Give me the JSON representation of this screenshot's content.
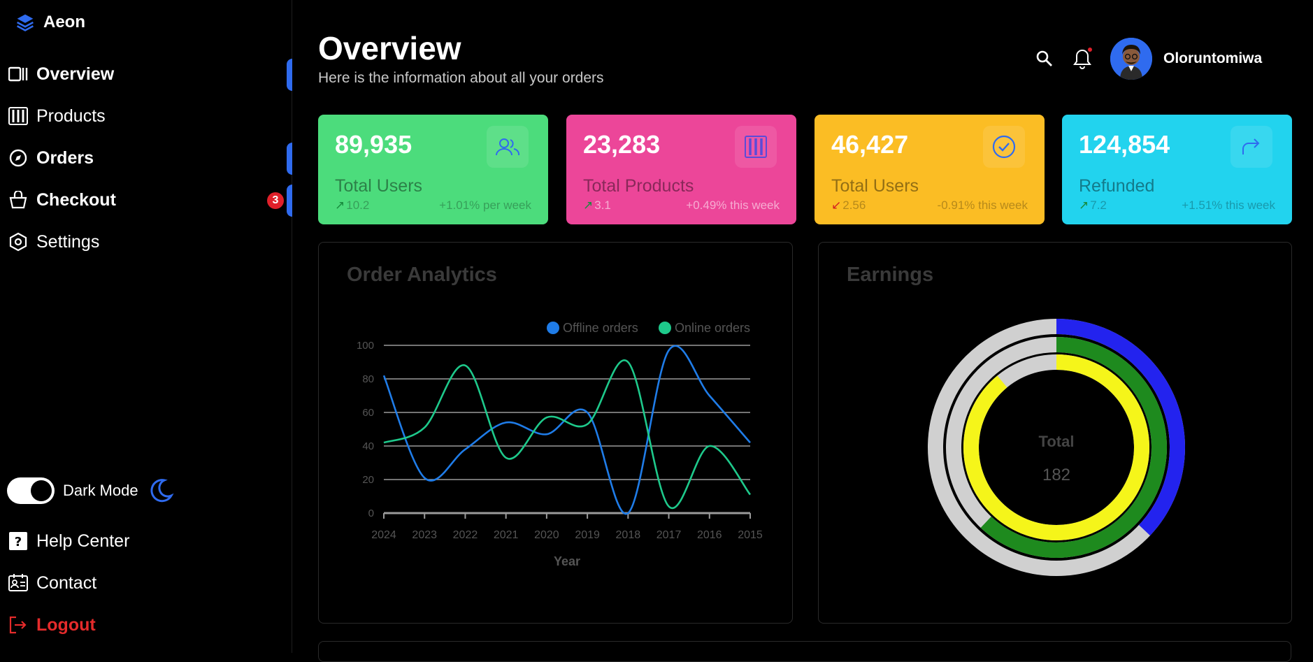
{
  "brand": {
    "name": "Aeon"
  },
  "sidebar": {
    "items": [
      {
        "label": "Overview",
        "bold": true,
        "active": true
      },
      {
        "label": "Products",
        "bold": false,
        "active": false
      },
      {
        "label": "Orders",
        "bold": true,
        "active": true
      },
      {
        "label": "Checkout",
        "bold": true,
        "active": true,
        "badge": "3"
      },
      {
        "label": "Settings",
        "bold": false,
        "active": false
      }
    ],
    "dark_mode_label": "Dark Mode",
    "dark_mode_on": true,
    "bottom": [
      {
        "label": "Help Center"
      },
      {
        "label": "Contact"
      },
      {
        "label": "Logout"
      }
    ]
  },
  "header": {
    "title": "Overview",
    "subtitle": "Here is the information about all your orders",
    "user_name": "Oloruntomiwa"
  },
  "cards": [
    {
      "value": "89,935",
      "label": "Total Users",
      "delta": "10.2",
      "trend": "+1.01% per week",
      "color": "#4cdc7c",
      "dir": "up"
    },
    {
      "value": "23,283",
      "label": "Total Products",
      "delta": "3.1",
      "trend": "+0.49% this week",
      "color": "#ec4699",
      "dir": "up"
    },
    {
      "value": "46,427",
      "label": "Total Users",
      "delta": "2.56",
      "trend": "-0.91% this week",
      "color": "#fbbd24",
      "dir": "down"
    },
    {
      "value": "124,854",
      "label": "Refunded",
      "delta": "7.2",
      "trend": "+1.51% this week",
      "color": "#22d3ee",
      "dir": "up"
    }
  ],
  "order_analytics": {
    "title": "Order Analytics",
    "chart_data": {
      "type": "line",
      "x": [
        "2024",
        "2023",
        "2022",
        "2021",
        "2020",
        "2019",
        "2018",
        "2017",
        "2016",
        "2015"
      ],
      "xlabel": "Year",
      "ylabel": "",
      "ylim": [
        0,
        100
      ],
      "yticks": [
        0,
        20,
        40,
        60,
        80,
        100
      ],
      "grid": true,
      "legend": "top-right",
      "series": [
        {
          "name": "Offline orders",
          "color": "#1f7ce8",
          "values": [
            82,
            21,
            38,
            54,
            47,
            60,
            0,
            97,
            70,
            42
          ]
        },
        {
          "name": "Online orders",
          "color": "#1ec98b",
          "values": [
            42,
            51,
            88,
            33,
            57,
            53,
            90,
            4,
            40,
            11
          ]
        }
      ]
    }
  },
  "earnings": {
    "title": "Earnings",
    "total_label": "Total",
    "total_value": "182",
    "chart_data": {
      "type": "pie",
      "rings": [
        {
          "fraction": 0.37,
          "color": "#2323ee",
          "track": "#d0d0d0"
        },
        {
          "fraction": 0.62,
          "color": "#1e8a1e",
          "track": "#d0d0d0"
        },
        {
          "fraction": 0.89,
          "color": "#f5f51a",
          "track": "#d0d0d0"
        }
      ]
    }
  }
}
